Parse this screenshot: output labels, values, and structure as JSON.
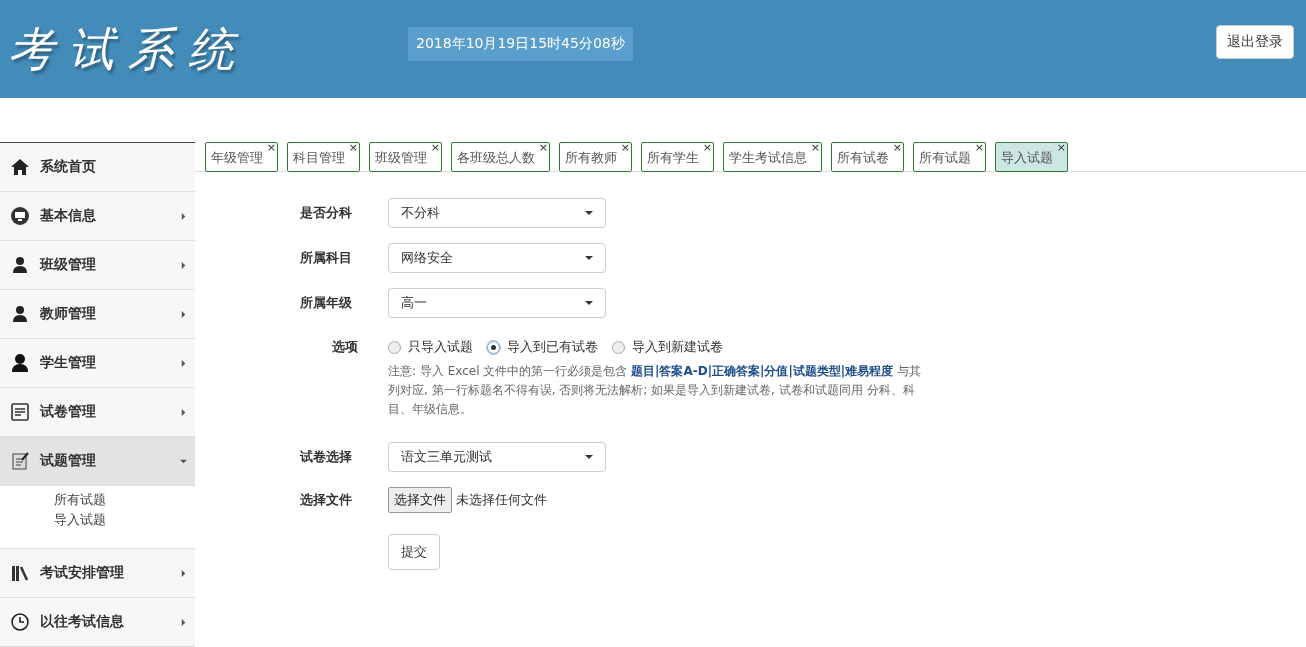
{
  "header": {
    "title": "考试系统",
    "datetime": "2018年10月19日15时45分08秒",
    "logout": "退出登录"
  },
  "sidebar": {
    "items": [
      {
        "label": "系统首页",
        "kind": "link",
        "expanded": false
      },
      {
        "label": "基本信息",
        "kind": "menu",
        "expanded": false
      },
      {
        "label": "班级管理",
        "kind": "menu",
        "expanded": false
      },
      {
        "label": "教师管理",
        "kind": "menu",
        "expanded": false
      },
      {
        "label": "学生管理",
        "kind": "menu",
        "expanded": false
      },
      {
        "label": "试卷管理",
        "kind": "menu",
        "expanded": false
      },
      {
        "label": "试题管理",
        "kind": "menu",
        "expanded": true,
        "children": [
          {
            "label": "所有试题"
          },
          {
            "label": "导入试题"
          }
        ]
      },
      {
        "label": "考试安排管理",
        "kind": "menu",
        "expanded": false
      },
      {
        "label": "以往考试信息",
        "kind": "menu",
        "expanded": false
      }
    ]
  },
  "tabs": [
    {
      "label": "年级管理",
      "close": "×",
      "selected": false
    },
    {
      "label": "科目管理",
      "close": "×",
      "selected": false
    },
    {
      "label": "班级管理",
      "close": "×",
      "selected": false
    },
    {
      "label": "各班级总人数",
      "close": "×",
      "selected": false
    },
    {
      "label": "所有教师",
      "close": "×",
      "selected": false
    },
    {
      "label": "所有学生",
      "close": "×",
      "selected": false
    },
    {
      "label": "学生考试信息",
      "close": "×",
      "selected": false
    },
    {
      "label": "所有试卷",
      "close": "×",
      "selected": false
    },
    {
      "label": "所有试题",
      "close": "×",
      "selected": false
    },
    {
      "label": "导入试题",
      "close": "×",
      "selected": true
    }
  ],
  "form": {
    "selects": [
      {
        "label": "是否分科",
        "value": "不分科"
      },
      {
        "label": "所属科目",
        "value": "网络安全"
      },
      {
        "label": "所属年级",
        "value": "高一"
      }
    ],
    "options": {
      "label": "选项",
      "choices": [
        {
          "label": "只导入试题",
          "selected": false
        },
        {
          "label": "导入到已有试卷",
          "selected": true
        },
        {
          "label": "导入到新建试卷",
          "selected": false
        }
      ],
      "note": "注意: 导入 Excel 文件中的第一行必须是包含 **题目|答案A-D|正确答案|分值|试题类型|难易程度** 与其列对应, 第一行标题名不得有误, 否则将无法解析; 如果是导入到新建试卷, 试卷和试题同用 分科、科目、年级信息。"
    },
    "paper": {
      "label": "试卷选择",
      "value": "语文三单元测试"
    },
    "file": {
      "label": "选择文件",
      "button": "选择文件",
      "status": "未选择任何文件"
    },
    "submit": "提交"
  }
}
